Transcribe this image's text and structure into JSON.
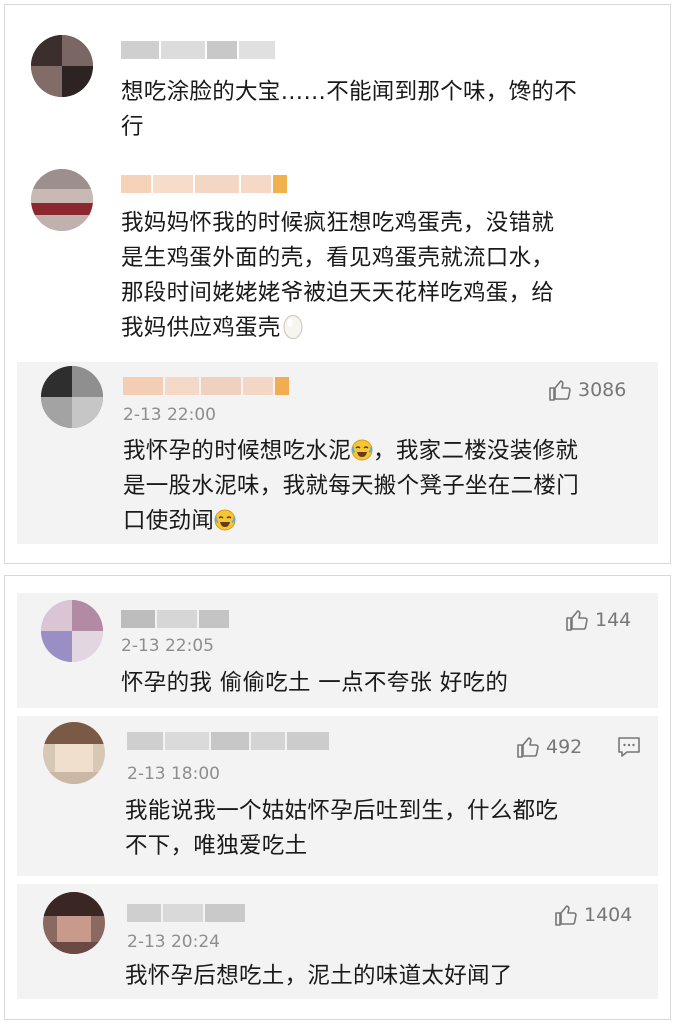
{
  "comments": [
    {
      "text_lines": [
        "想吃涂脸的大宝……不能闻到那个味，馋的不",
        "行"
      ]
    },
    {
      "text_lines": [
        "我妈妈怀我的时候疯狂想吃鸡蛋壳，没错就",
        "是生鸡蛋外面的壳，看见鸡蛋壳就流口水，",
        "那段时间姥姥姥爷被迫天天花样吃鸡蛋，给",
        "我妈供应鸡蛋壳"
      ],
      "trailing_emoji": "egg"
    },
    {
      "time": "2-13 22:00",
      "likes": "3086",
      "text_lines": [
        "我怀孕的时候想吃水泥",
        "，我家二楼没装修就",
        "是一股水泥味，我就每天搬个凳子坐在二楼门",
        "口使劲闻"
      ],
      "emoji": "laugh-cry"
    },
    {
      "time": "2-13 22:05",
      "likes": "144",
      "text_lines": [
        "怀孕的我 偷偷吃土 一点不夸张 好吃的"
      ]
    },
    {
      "time": "2-13 18:00",
      "likes": "492",
      "text_lines": [
        "我能说我一个姑姑怀孕后吐到生，什么都吃",
        "不下，唯独爱吃土"
      ],
      "has_reply_icon": true
    },
    {
      "time": "2-13 20:24",
      "likes": "1404",
      "text_lines": [
        "我怀孕后想吃土，泥土的味道太好闻了"
      ]
    }
  ],
  "icons": {
    "like": "thumbs-up-icon",
    "reply": "comment-icon"
  },
  "colors": {
    "text": "#1a1a1a",
    "meta": "#8e8e8e",
    "reply_bg": "#f3f3f3"
  }
}
